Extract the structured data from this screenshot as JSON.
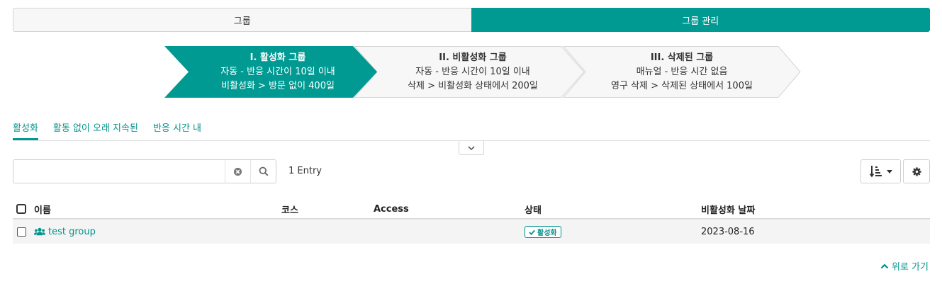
{
  "top_tabs": [
    {
      "label": "그룹",
      "active": false
    },
    {
      "label": "그룹 관리",
      "active": true
    }
  ],
  "stages": [
    {
      "title": "I. 활성화 그룹",
      "line1": "자동 - 반응 시간이 10일 이내",
      "line2": "비활성화 > 방문 없이 400일",
      "active": true
    },
    {
      "title": "II. 비활성화 그룹",
      "line1": "자동 - 반응 시간이 10일 이내",
      "line2": "삭제 > 비활성화 상태에서 200일",
      "active": false
    },
    {
      "title": "III. 삭제된 그룹",
      "line1": "매뉴얼 - 반응 시간 없음",
      "line2": "영구 삭제 > 삭제된 상태에서 100일",
      "active": false
    }
  ],
  "sub_tabs": [
    {
      "label": "활성화",
      "active": true
    },
    {
      "label": "활동 없이 오래 지속된",
      "active": false
    },
    {
      "label": "반응 시간 내",
      "active": false
    }
  ],
  "search": {
    "value": "",
    "placeholder": ""
  },
  "entry_count": "1 Entry",
  "table": {
    "columns": [
      "이름",
      "코스",
      "Access",
      "상태",
      "비활성화 날짜"
    ],
    "rows": [
      {
        "name": "test group",
        "course": "",
        "access": "",
        "status": "활성화",
        "date": "2023-08-16"
      }
    ]
  },
  "back_to_top": "위로 가기",
  "colors": {
    "accent": "#009a93",
    "link": "#00928b",
    "row_bg": "#f4f4f4"
  },
  "icons": {
    "collapse": "chevron-down-icon",
    "clear": "circle-x-icon",
    "search": "magnifier-icon",
    "sort": "sort-amount-icon",
    "settings": "gear-icon",
    "group": "users-icon",
    "status": "check-icon",
    "back_to_top": "chevron-up-icon"
  }
}
